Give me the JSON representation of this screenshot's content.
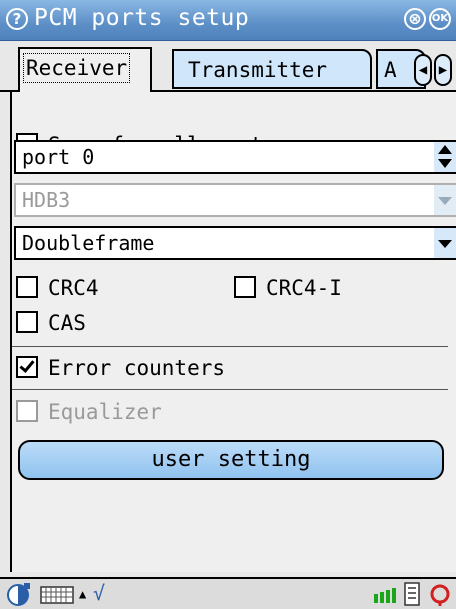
{
  "window": {
    "title": "PCM ports setup",
    "help_icon": "?",
    "close_icon": "⊗",
    "ok_label": "OK"
  },
  "tabs": [
    {
      "label": "Receiver",
      "active": true
    },
    {
      "label": "Transmitter",
      "active": false
    },
    {
      "label": "A",
      "active": false
    }
  ],
  "tab_nav": {
    "left": "◀",
    "right": "▶"
  },
  "form": {
    "same_for_all": {
      "label": "Same for all ports",
      "checked": false
    },
    "port_select": {
      "value": "port 0"
    },
    "line_code": {
      "value": "HDB3",
      "enabled": false
    },
    "frame_type": {
      "value": "Doubleframe"
    },
    "crc4": {
      "label": "CRC4",
      "checked": false
    },
    "crc4i": {
      "label": "CRC4-I",
      "checked": false
    },
    "cas": {
      "label": "CAS",
      "checked": false
    },
    "error_counters": {
      "label": "Error counters",
      "checked": true
    },
    "equalizer": {
      "label": "Equalizer",
      "checked": false,
      "enabled": false
    },
    "user_setting_button": "user setting"
  },
  "taskbar": {
    "start_icon": "start-icon",
    "keyboard_icon": "keyboard-icon",
    "up_arrow": "▲",
    "check_mark": "√"
  },
  "colors": {
    "titlebar": "#5d8fc7",
    "tab_inactive": "#cfe6fb",
    "button": "#a7d0f4",
    "signal_green": "#1aa51a",
    "power_red": "#d22020"
  }
}
